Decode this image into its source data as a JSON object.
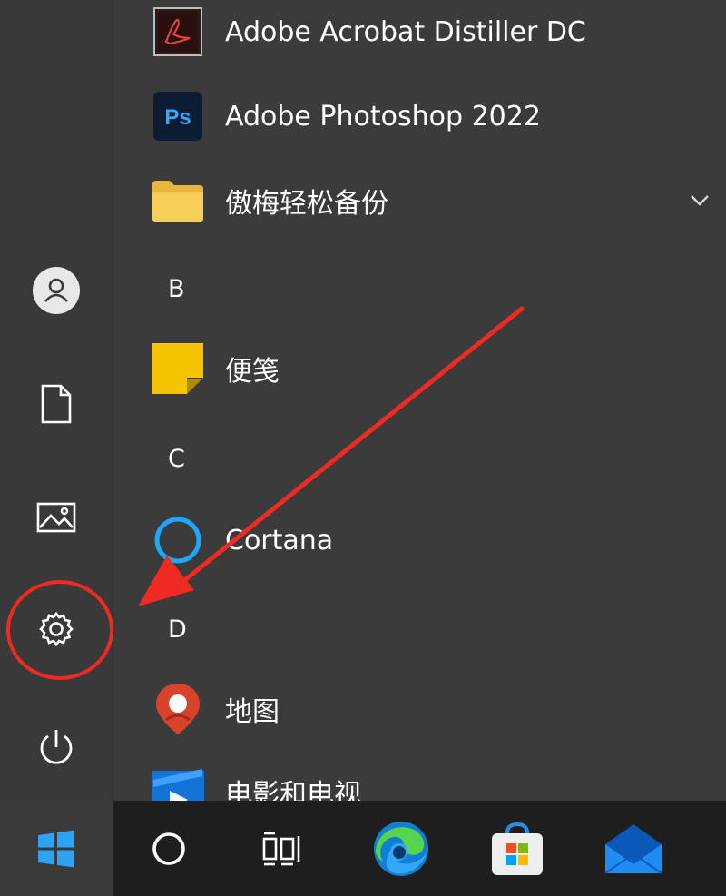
{
  "sidebar": {
    "items": [
      {
        "icon": "user-icon"
      },
      {
        "icon": "document-icon"
      },
      {
        "icon": "pictures-icon"
      },
      {
        "icon": "settings-gear-icon"
      },
      {
        "icon": "power-icon"
      }
    ]
  },
  "app_list": {
    "apps": [
      {
        "label": "Adobe Acrobat Distiller DC",
        "icon": "acrobat-distiller-icon"
      },
      {
        "label": "Adobe Photoshop 2022",
        "icon": "photoshop-icon",
        "icon_text": "Ps"
      },
      {
        "label": "傲梅轻松备份",
        "icon": "folder-icon",
        "expandable": true
      },
      {
        "label": "便笺",
        "icon": "sticky-notes-icon"
      },
      {
        "label": "Cortana",
        "icon": "cortana-icon"
      },
      {
        "label": "地图",
        "icon": "maps-icon"
      },
      {
        "label": "电影和电视",
        "icon": "movies-tv-icon"
      }
    ],
    "letters": [
      "B",
      "C",
      "D"
    ]
  },
  "taskbar": {
    "items": [
      {
        "icon": "windows-start-icon",
        "active": true
      },
      {
        "icon": "cortana-search-icon"
      },
      {
        "icon": "task-view-icon"
      },
      {
        "icon": "edge-browser-icon"
      },
      {
        "icon": "microsoft-store-icon"
      },
      {
        "icon": "mail-icon"
      }
    ]
  },
  "annotation": {
    "color": "#ee2a22",
    "marks": [
      "red-circle-around-settings",
      "red-arrow-pointing-to-settings"
    ]
  }
}
